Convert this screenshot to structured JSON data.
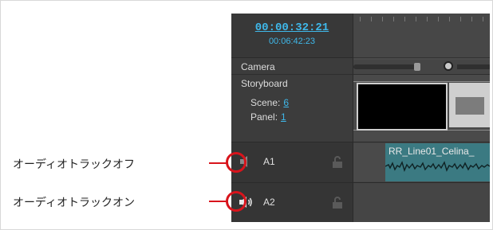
{
  "labels": {
    "audio_off": "オーディオトラックオフ",
    "audio_on": "オーディオトラックオン"
  },
  "timecode": {
    "current": "00:00:32:21",
    "total": "00:06:42:23"
  },
  "layers": {
    "camera": "Camera",
    "storyboard": "Storyboard",
    "scene_label": "Scene:",
    "scene_value": "6",
    "panel_label": "Panel:",
    "panel_value": "1"
  },
  "audio_tracks": [
    {
      "name": "A1",
      "state": "muted",
      "icon": "speaker-muted-icon"
    },
    {
      "name": "A2",
      "state": "unmuted",
      "icon": "speaker-on-icon"
    }
  ],
  "clip": {
    "label": "RR_Line01_Celina_"
  },
  "colors": {
    "accent": "#3fb8ea",
    "callout": "#d8141c",
    "clip": "#3b7a82"
  }
}
